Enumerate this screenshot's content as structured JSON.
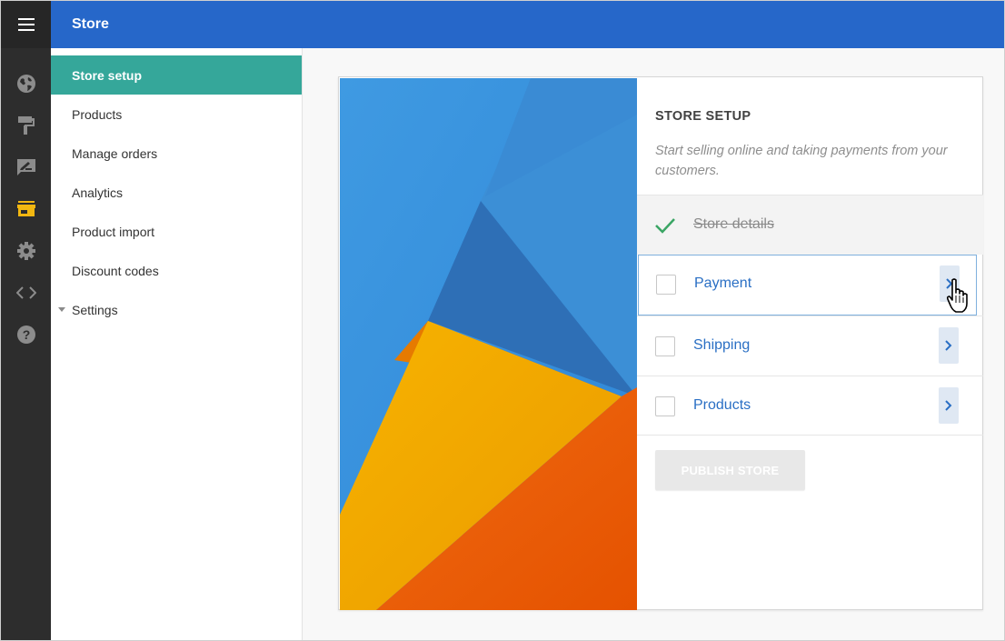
{
  "header": {
    "title": "Store"
  },
  "rail": {
    "icons": [
      "menu-icon",
      "globe-icon",
      "paint-roller-icon",
      "signature-icon",
      "store-icon",
      "gear-icon",
      "code-icon",
      "help-icon"
    ],
    "active_color": "#f2b711"
  },
  "sidebar": {
    "items": [
      {
        "label": "Store setup",
        "active": true
      },
      {
        "label": "Products"
      },
      {
        "label": "Manage orders"
      },
      {
        "label": "Analytics"
      },
      {
        "label": "Product import"
      },
      {
        "label": "Discount codes"
      },
      {
        "label": "Settings",
        "expandable": true
      }
    ]
  },
  "setup": {
    "heading": "STORE SETUP",
    "subtitle": "Start selling online and taking payments from your customers.",
    "tasks": [
      {
        "label": "Store details",
        "done": true
      },
      {
        "label": "Payment",
        "done": false
      },
      {
        "label": "Shipping",
        "done": false
      },
      {
        "label": "Products",
        "done": false
      }
    ],
    "publish_label": "PUBLISH STORE"
  },
  "colors": {
    "topbar": "#2667c9",
    "rail": "#2d2d2d",
    "active_item": "#35a79a",
    "link": "#2a6fc4",
    "check": "#3aa564"
  }
}
